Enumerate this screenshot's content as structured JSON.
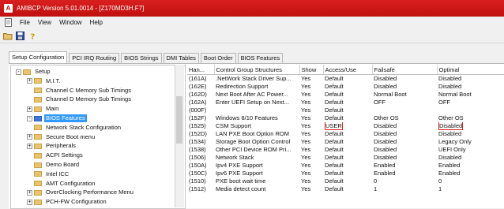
{
  "window": {
    "title": "AMIBCP Version 5.01.0014 - [Z170MD3H.F7]"
  },
  "menu": [
    "File",
    "View",
    "Window",
    "Help"
  ],
  "toolbar": {
    "icons": [
      "open-icon",
      "save-icon",
      "help-icon"
    ]
  },
  "tabs": [
    "Setup Configuration",
    "PCI IRQ Routing",
    "BIOS Strings",
    "DMI Tables",
    "Boot Order",
    "BIOS Features"
  ],
  "tree": [
    {
      "label": "Setup",
      "level": 0,
      "expander": "-"
    },
    {
      "label": "M.I.T.",
      "level": 1,
      "expander": "+"
    },
    {
      "label": "Channel C Memory Sub Timings",
      "level": 1,
      "expander": ""
    },
    {
      "label": "Channel D Memory Sub Timings",
      "level": 1,
      "expander": ""
    },
    {
      "label": "Main",
      "level": 1,
      "expander": "+"
    },
    {
      "label": "BIOS Features",
      "level": 1,
      "expander": "-",
      "selected": true
    },
    {
      "label": "Network Stack Configuration",
      "level": 1,
      "expander": ""
    },
    {
      "label": "Secure Boot menu",
      "level": 1,
      "expander": "+"
    },
    {
      "label": "Peripherals",
      "level": 1,
      "expander": "+"
    },
    {
      "label": "ACPI Settings",
      "level": 1,
      "expander": ""
    },
    {
      "label": "Demo Board",
      "level": 1,
      "expander": ""
    },
    {
      "label": "Intel ICC",
      "level": 1,
      "expander": ""
    },
    {
      "label": "AMT Configuration",
      "level": 1,
      "expander": ""
    },
    {
      "label": "OverClocking Performance Menu",
      "level": 1,
      "expander": "+"
    },
    {
      "label": "PCH-FW Configuration",
      "level": 1,
      "expander": "+"
    }
  ],
  "grid": {
    "columns": [
      "Han...",
      "Control Group Structures",
      "Show",
      "Access/Use",
      "Failsafe",
      "Optimal"
    ],
    "rows": [
      [
        "(161A)",
        ".NetWork Stack Driver Sup...",
        "Yes",
        "Default",
        "Disabled",
        "Disabled"
      ],
      [
        "(162E)",
        "Redirection Support",
        "Yes",
        "Default",
        "Disabled",
        "Disabled"
      ],
      [
        "(162D)",
        "Next Boot After AC Power...",
        "Yes",
        "Default",
        "Normal Boot",
        "Normal Boot"
      ],
      [
        "(162A)",
        "Enter UEFI Setup on Next...",
        "Yes",
        "Default",
        "OFF",
        "OFF"
      ],
      [
        "(000F)",
        "",
        "Yes",
        "Default",
        "",
        ""
      ],
      [
        "(152F)",
        "Windows 8/10 Features",
        "Yes",
        "Default",
        "Other OS",
        "Other OS"
      ],
      [
        "(1525)",
        "CSM Support",
        "Yes",
        "USER",
        "Disabled",
        "Disabled"
      ],
      [
        "(152D)",
        "LAN PXE Boot Option ROM",
        "Yes",
        "Default",
        "Disabled",
        "Disabled"
      ],
      [
        "(1534)",
        "Storage Boot Option Control",
        "Yes",
        "Default",
        "Disabled",
        "Legacy Only"
      ],
      [
        "(1538)",
        "Other PCI Device ROM Pri...",
        "Yes",
        "Default",
        "Disabled",
        "UEFI Only"
      ],
      [
        "(1506)",
        "Network Stack",
        "Yes",
        "Default",
        "Disabled",
        "Disabled"
      ],
      [
        "(150A)",
        "Ipv4 PXE Support",
        "Yes",
        "Default",
        "Enabled",
        "Enabled"
      ],
      [
        "(150C)",
        "Ipv6 PXE Support",
        "Yes",
        "Default",
        "Enabled",
        "Enabled"
      ],
      [
        "(1510)",
        "PXE boot wait time",
        "Yes",
        "Default",
        "0",
        "0"
      ],
      [
        "(1512)",
        "Media detect count",
        "Yes",
        "Default",
        "1",
        "1"
      ]
    ],
    "highlighted_cells": [
      [
        6,
        3
      ],
      [
        6,
        5
      ]
    ],
    "highlight_color": "#e0201e"
  },
  "colors": {
    "titlebar": "#c8181a",
    "selection": "#3399ff"
  }
}
